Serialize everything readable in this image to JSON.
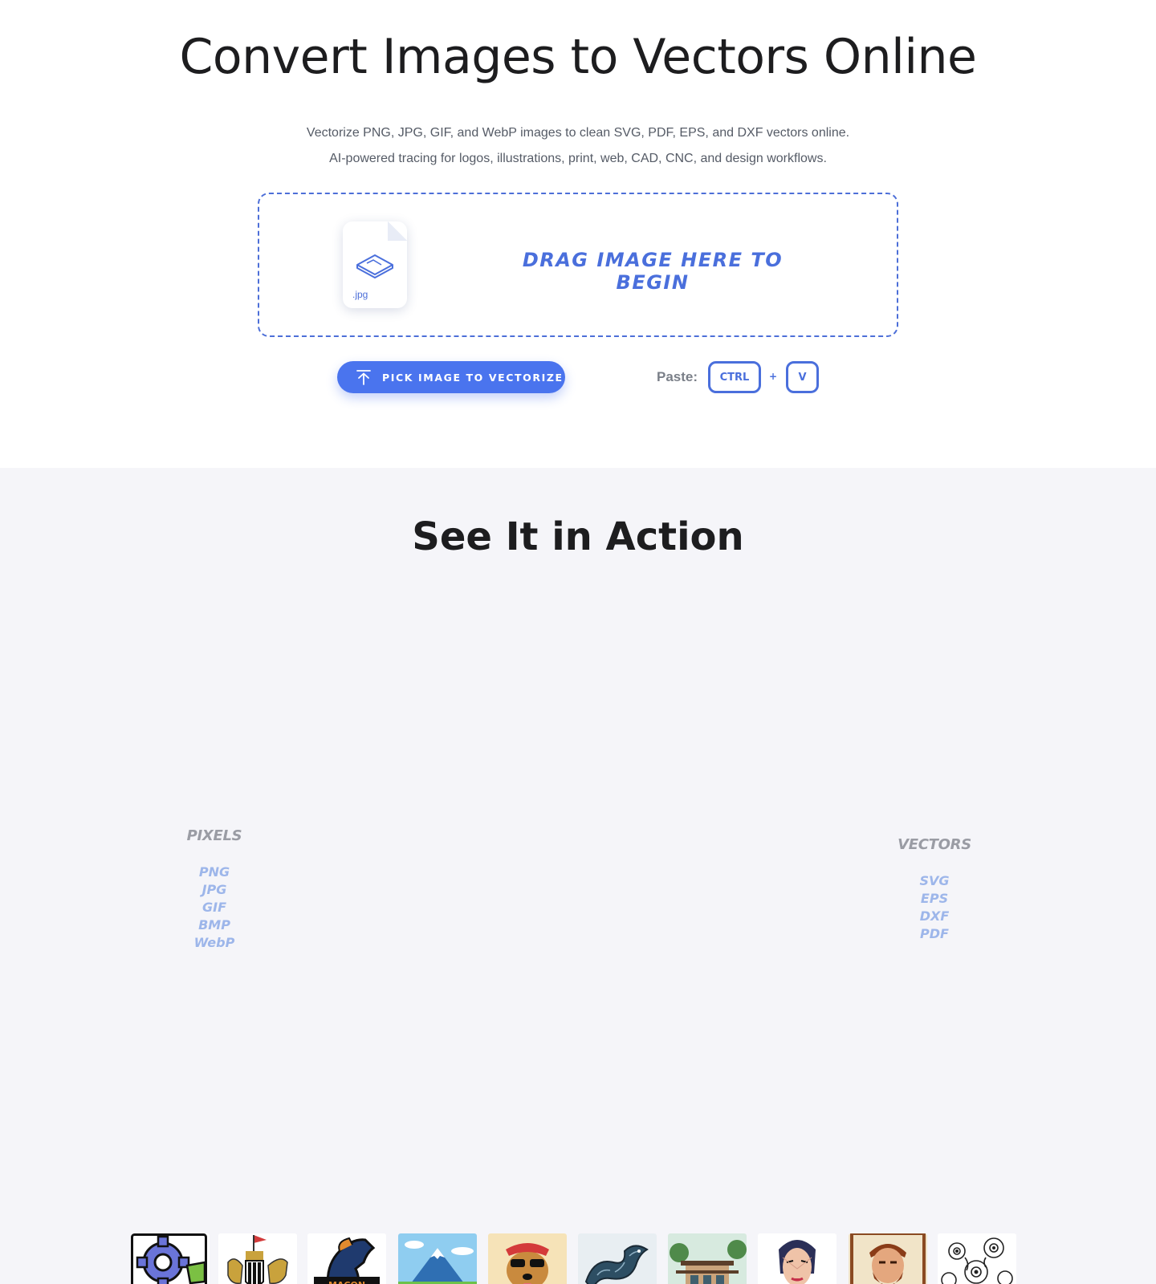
{
  "hero": {
    "title": "Convert Images to Vectors Online",
    "subtitle_line1": "Vectorize PNG, JPG, GIF, and WebP images to clean SVG, PDF, EPS, and DXF vectors online.",
    "subtitle_line2": "AI-powered tracing for logos, illustrations, print, web, CAD, CNC, and design workflows."
  },
  "dropzone": {
    "file_ext": ".jpg",
    "text": "DRAG IMAGE HERE TO BEGIN",
    "accent_color": "#4a6fdc"
  },
  "actions": {
    "pick_label": "PICK IMAGE TO VECTORIZE",
    "pick_icon": "upload-icon",
    "paste_label": "Paste:",
    "key_ctrl": "CTRL",
    "plus": "+",
    "key_v": "V",
    "button_color": "#4a74ee"
  },
  "action_section": {
    "title": "See It in Action",
    "pixels": {
      "heading": "PIXELS",
      "formats": [
        "PNG",
        "JPG",
        "GIF",
        "BMP",
        "WebP"
      ]
    },
    "vectors": {
      "heading": "VECTORS",
      "formats": [
        "SVG",
        "EPS",
        "DXF",
        "PDF"
      ]
    },
    "examples": [
      "gear-icon",
      "crest-icon",
      "horse-logo-icon",
      "mountain-icon",
      "dog-icon",
      "dragon-icon",
      "house-icon",
      "woman-portrait-icon",
      "bearded-man-icon",
      "floral-pattern-icon"
    ]
  }
}
